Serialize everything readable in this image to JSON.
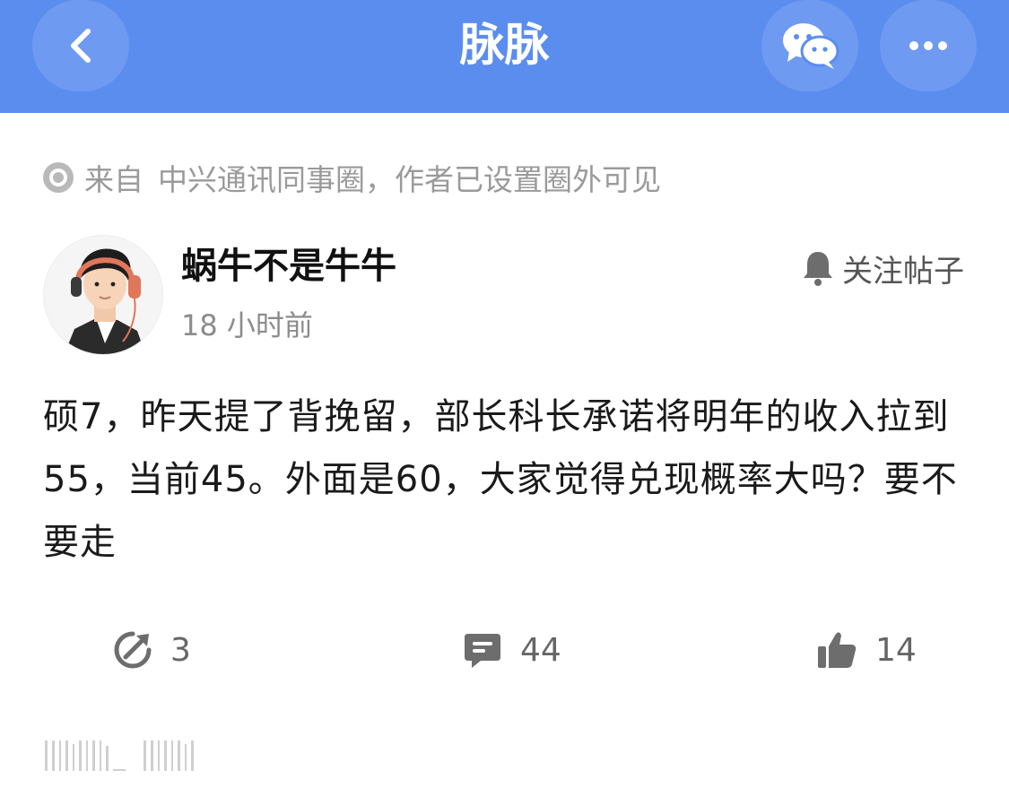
{
  "app": {
    "title": "脉脉"
  },
  "nav": {
    "back_icon": "chevron-left-icon",
    "share_icon": "wechat-icon",
    "more_icon": "more-dots-icon"
  },
  "post": {
    "source_prefix": "来自",
    "source_text": "中兴通讯同事圈，作者已设置圈外可见",
    "author": "蜗牛不是牛牛",
    "time": "18 小时前",
    "follow_label": "关注帖子",
    "body": "硕7，昨天提了背挽留，部长科长承诺将明年的收入拉到55，当前45。外面是60，大家觉得兑现概率大吗？要不要走"
  },
  "actions": {
    "share_count": "3",
    "comment_count": "44",
    "like_count": "14"
  },
  "colors": {
    "nav_bg": "#5b8def",
    "icon_gray": "#6d6d6d",
    "text_gray": "#9a9a9a"
  }
}
